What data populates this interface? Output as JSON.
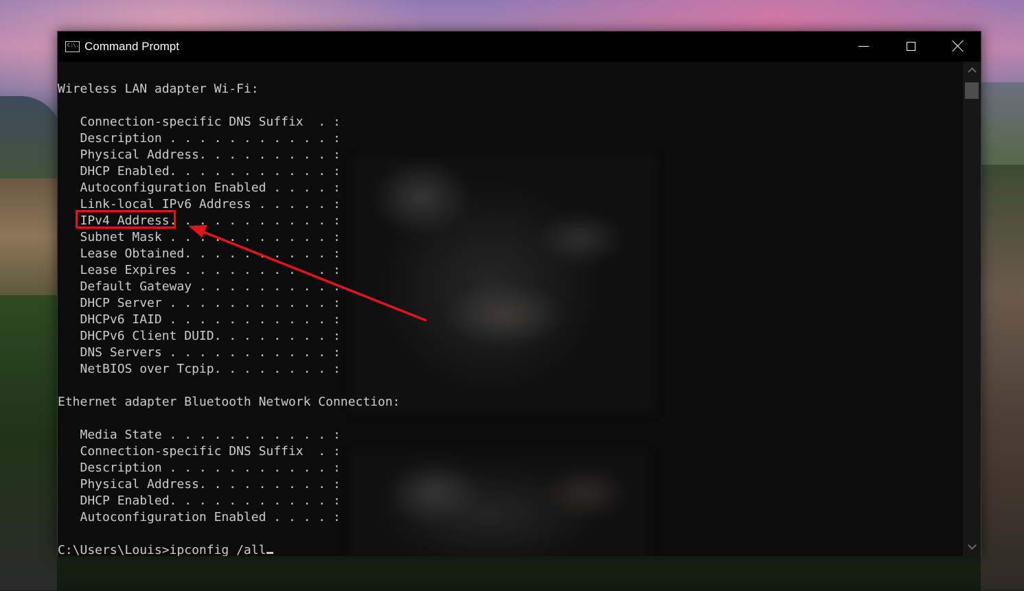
{
  "window": {
    "title": "Command Prompt",
    "icon": "console-icon",
    "icon_text": "C:\\."
  },
  "console": {
    "lines": [
      "",
      "Wireless LAN adapter Wi-Fi:",
      "",
      "   Connection-specific DNS Suffix  . :",
      "   Description . . . . . . . . . . . :",
      "   Physical Address. . . . . . . . . :",
      "   DHCP Enabled. . . . . . . . . . . :",
      "   Autoconfiguration Enabled . . . . :",
      "   Link-local IPv6 Address . . . . . :",
      "   IPv4 Address. . . . . . . . . . . :",
      "   Subnet Mask . . . . . . . . . . . :",
      "   Lease Obtained. . . . . . . . . . :",
      "   Lease Expires . . . . . . . . . . :",
      "   Default Gateway . . . . . . . . . :",
      "   DHCP Server . . . . . . . . . . . :",
      "   DHCPv6 IAID . . . . . . . . . . . :",
      "   DHCPv6 Client DUID. . . . . . . . :",
      "   DNS Servers . . . . . . . . . . . :",
      "   NetBIOS over Tcpip. . . . . . . . :",
      "",
      "Ethernet adapter Bluetooth Network Connection:",
      "",
      "   Media State . . . . . . . . . . . :",
      "   Connection-specific DNS Suffix  . :",
      "   Description . . . . . . . . . . . :",
      "   Physical Address. . . . . . . . . :",
      "   DHCP Enabled. . . . . . . . . . . :",
      "   Autoconfiguration Enabled . . . . :",
      "",
      "C:\\Users\\Louis>ipconfig /all"
    ]
  },
  "annotation": {
    "highlight_color": "#e3151c",
    "highlighted_label": "IPv4 Address"
  },
  "colors": {
    "console_bg": "#0c0c0c",
    "console_text": "#cccccc",
    "titlebar_bg": "#000000"
  }
}
